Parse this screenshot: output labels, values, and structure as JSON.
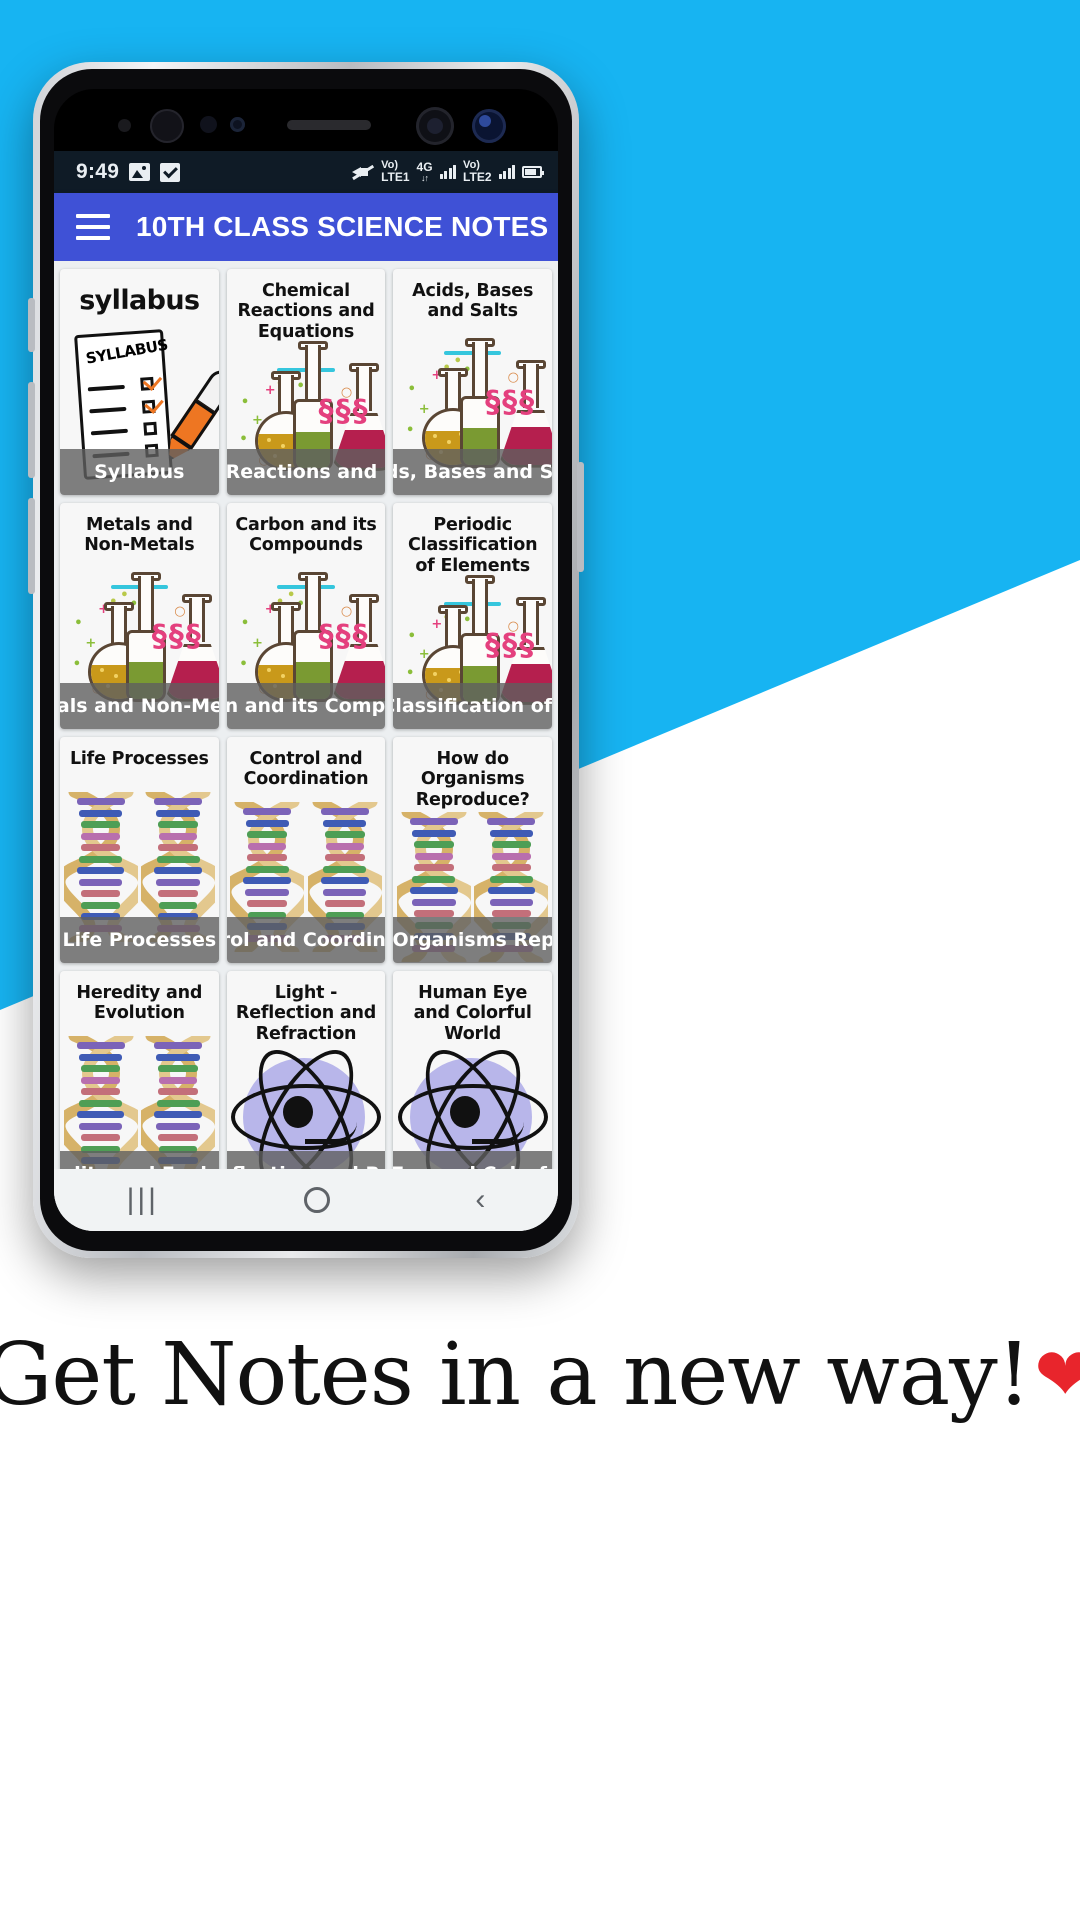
{
  "background": {
    "accent_color": "#17B4F2",
    "wedge_color": "#FFFFFF"
  },
  "phone": {
    "status_bar": {
      "time": "9:49",
      "left_icons": [
        "image-icon",
        "checkbox-icon"
      ],
      "right_icons": [
        "mute-icon",
        "signal-bars-icon",
        "signal-bars-icon",
        "battery-icon"
      ],
      "volte_label_top": "Vo)",
      "volte_label_bottom": "LTE1",
      "network_label": "4G",
      "network_arrows": "↓↑",
      "volte2_label_top": "Vo)",
      "volte2_label_bottom": "LTE2"
    },
    "app_bar": {
      "menu_icon": "hamburger-menu-icon",
      "title": "10TH CLASS SCIENCE NOTES",
      "background_color": "#3F51D6"
    },
    "nav_bar": {
      "recent_label": "|||",
      "home_label": "home-circle-icon",
      "back_label": "‹"
    }
  },
  "grid": {
    "cards": [
      {
        "title": "syllabus",
        "label": "Syllabus",
        "art": "syllabus",
        "title_style": "big"
      },
      {
        "title": "Chemical Reactions and Equations",
        "label": "Chemical Reactions and Equations",
        "art": "flask",
        "title_style": "normal"
      },
      {
        "title": "Acids, Bases and Salts",
        "label": "Acids, Bases and Salts",
        "art": "flask",
        "title_style": "normal"
      },
      {
        "title": "Metals and Non-Metals",
        "label": "Metals and Non-Metals",
        "art": "flask",
        "title_style": "normal"
      },
      {
        "title": "Carbon and its Compounds",
        "label": "Carbon and its Compounds",
        "art": "flask",
        "title_style": "normal"
      },
      {
        "title": "Periodic Classification of Elements",
        "label": "Periodic Classification of Elements",
        "art": "flask",
        "title_style": "normal"
      },
      {
        "title": "Life Processes",
        "label": "Life Processes",
        "art": "dna",
        "title_style": "normal"
      },
      {
        "title": "Control and Coordination",
        "label": "Control and Coordination",
        "art": "dna",
        "title_style": "normal"
      },
      {
        "title": "How do Organisms Reproduce?",
        "label": "How do Organisms Reproduce?",
        "art": "dna",
        "title_style": "normal"
      },
      {
        "title": "Heredity and Evolution",
        "label": "Heredity and Evolution",
        "art": "dna",
        "title_style": "normal"
      },
      {
        "title": "Light - Reflection and Refraction",
        "label": "Light- Reflection and Refraction",
        "art": "atom",
        "title_style": "normal"
      },
      {
        "title": "Human Eye and Colorful World",
        "label": "Human Eye and Colorful World",
        "art": "atom",
        "title_style": "normal"
      }
    ]
  },
  "tagline": {
    "text": "Get Notes in a new way!",
    "heart": "❤"
  }
}
